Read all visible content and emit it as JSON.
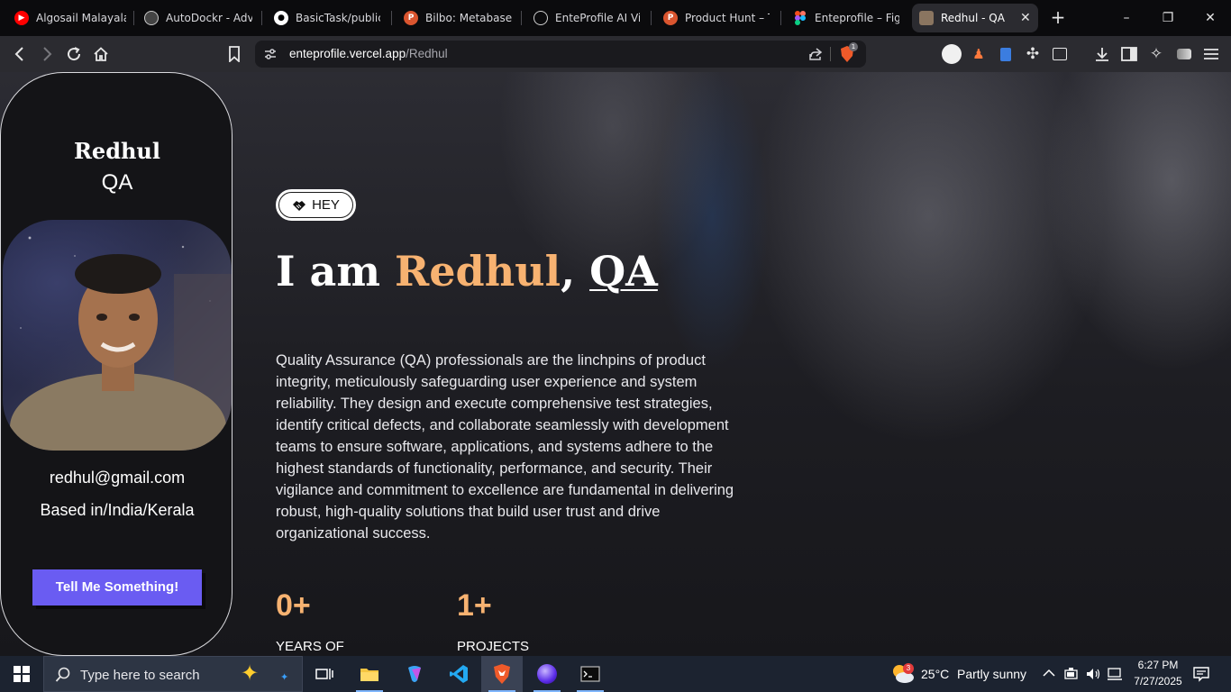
{
  "browser": {
    "tabs": [
      {
        "title": "Algosail Malayalam",
        "favicon": "youtube-icon",
        "color": "#ff0000"
      },
      {
        "title": "AutoDockr - Advanced",
        "favicon": "autodockr-icon",
        "color": "#9aa0a6"
      },
      {
        "title": "BasicTask/public/C",
        "favicon": "github-icon",
        "color": "#ffffff"
      },
      {
        "title": "Bilbo: Metabase AI",
        "favicon": "producthunt-icon",
        "color": "#da552f"
      },
      {
        "title": "EnteProfile AI Video",
        "favicon": "openai-icon",
        "color": "#cfcfcf"
      },
      {
        "title": "Product Hunt – The",
        "favicon": "producthunt-icon",
        "color": "#da552f"
      },
      {
        "title": "Enteprofile – Figma",
        "favicon": "figma-icon",
        "color": "#a259ff"
      },
      {
        "title": "Redhul - QA |",
        "favicon": "profile-photo-icon",
        "color": "#8a7560"
      }
    ],
    "new_tab": "+",
    "window_controls": [
      "–",
      "❐",
      "✕"
    ],
    "url": {
      "domain": "enteprofile.vercel.app",
      "path": "/Redhul"
    },
    "shield_badge": "1"
  },
  "profile": {
    "name": "Redhul",
    "role": "QA",
    "email": "redhul@gmail.com",
    "location": "Based in/India/Kerala",
    "cta": "Tell Me Something!"
  },
  "hero": {
    "badge": "HEY",
    "intro": "I am ",
    "name": "Redhul",
    "comma": ", ",
    "role": "QA",
    "description": "Quality Assurance (QA) professionals are the linchpins of product integrity, meticulously safeguarding user experience and system reliability. They design and execute comprehensive test strategies, identify critical defects, and collaborate seamlessly with development teams to ensure software, applications, and systems adhere to the highest standards of functionality, performance, and security. Their vigilance and commitment to excellence are fundamental in delivering robust, high-quality solutions that build user trust and drive organizational success."
  },
  "stats": [
    {
      "value": "0+",
      "label": "YEARS OF"
    },
    {
      "value": "1+",
      "label": "PROJECTS"
    }
  ],
  "taskbar": {
    "search_placeholder": "Type here to search",
    "weather": {
      "temp": "25°C",
      "condition": "Partly sunny",
      "badge": "3"
    },
    "time": "6:27 PM",
    "date": "7/27/2025"
  },
  "colors": {
    "accent_orange": "#f7b271",
    "cta_purple": "#6a5cf2"
  }
}
